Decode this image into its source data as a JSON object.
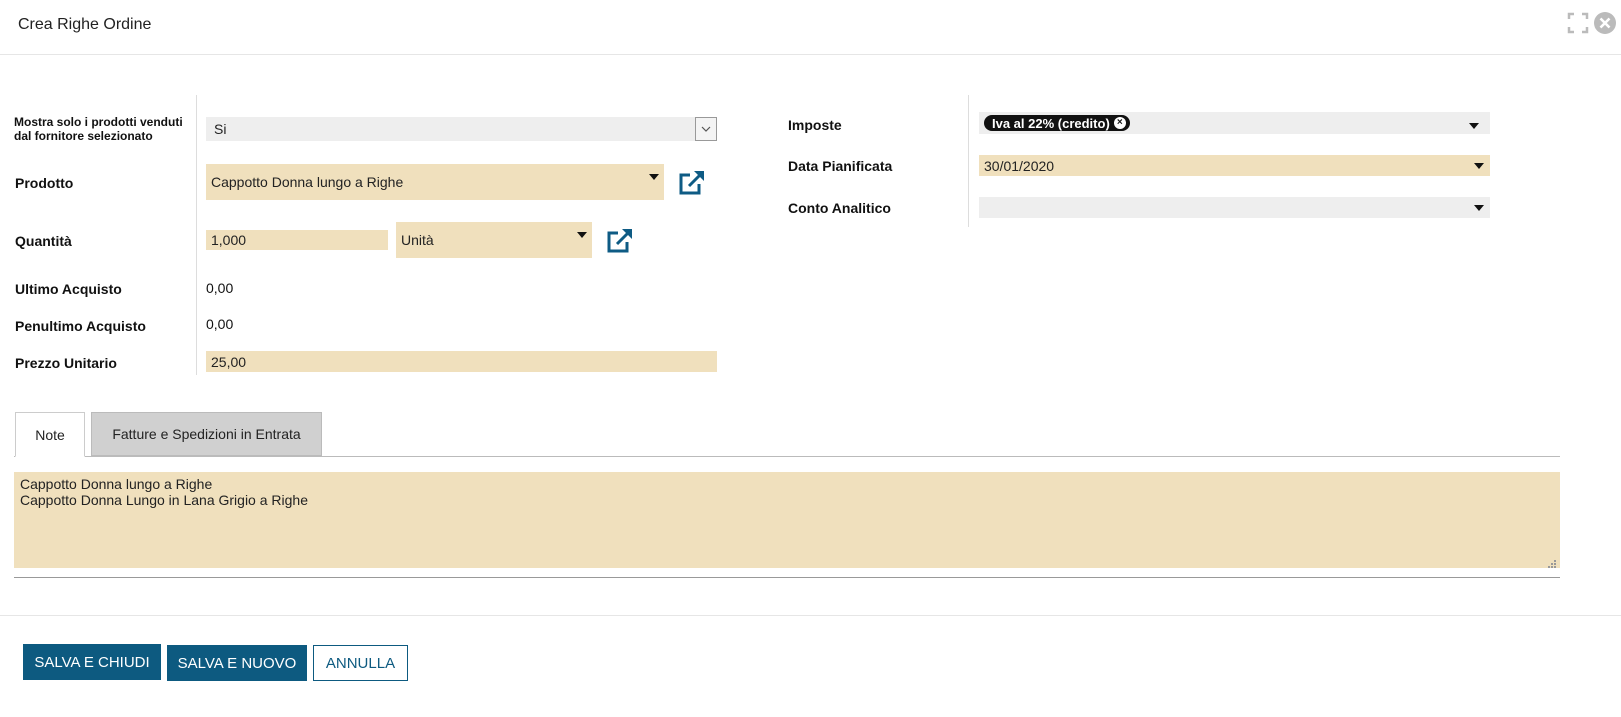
{
  "dialog": {
    "title": "Crea Righe Ordine"
  },
  "left_fields": {
    "mostra_solo": {
      "label": "Mostra solo i prodotti venduti dal fornitore selezionato",
      "value": "Si"
    },
    "prodotto": {
      "label": "Prodotto",
      "value": "Cappotto Donna lungo a Righe"
    },
    "quantita": {
      "label": "Quantità",
      "value": "1,000",
      "uom": "Unità"
    },
    "ultimo_acquisto": {
      "label": "Ultimo Acquisto",
      "value": "0,00"
    },
    "penultimo_acquisto": {
      "label": "Penultimo Acquisto",
      "value": "0,00"
    },
    "prezzo_unitario": {
      "label": "Prezzo Unitario",
      "value": "25,00"
    }
  },
  "right_fields": {
    "imposte": {
      "label": "Imposte",
      "tag": "Iva al 22% (credito)"
    },
    "data_pianificata": {
      "label": "Data Pianificata",
      "value": "30/01/2020"
    },
    "conto_analitico": {
      "label": "Conto Analitico",
      "value": ""
    }
  },
  "tabs": [
    {
      "label": "Note",
      "active": true
    },
    {
      "label": "Fatture e Spedizioni in Entrata",
      "active": false
    }
  ],
  "notes_text": "Cappotto Donna lungo a Righe\nCappotto Donna Lungo in Lana Grigio a Righe",
  "buttons": {
    "save_close": "SALVA E CHIUDI",
    "save_new": "SALVA E NUOVO",
    "cancel": "ANNULLA"
  },
  "icons": {
    "expand": "expand-icon",
    "close": "close-icon",
    "external_link": "external-link-icon",
    "caret": "caret-down-icon"
  },
  "colors": {
    "field_bg": "#f0e0bd",
    "primary": "#0d5a80",
    "link_icon": "#0e5b84"
  }
}
